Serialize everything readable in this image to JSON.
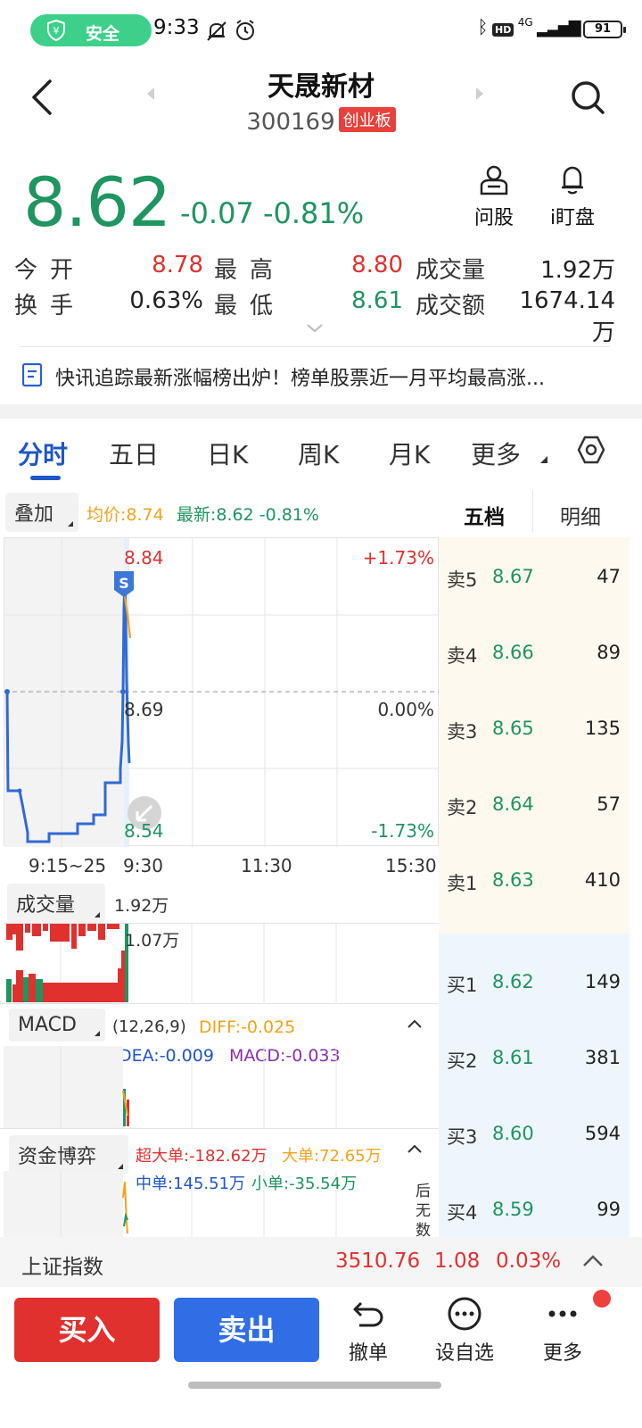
{
  "status_bar": {
    "safe_label": "安全",
    "time": "9:33",
    "battery": "91",
    "network": "4G"
  },
  "header": {
    "title": "天晟新材",
    "code": "300169",
    "board": "创业板"
  },
  "quote": {
    "price": "8.62",
    "change": "-0.07",
    "change_pct": "-0.81%",
    "ask_label": "问股",
    "watch_label": "i盯盘"
  },
  "stats": [
    {
      "label": "今开",
      "value": "8.78",
      "color": "red"
    },
    {
      "label": "最高",
      "value": "8.80",
      "color": "red"
    },
    {
      "label": "成交量",
      "value": "1.92万",
      "color": "dark"
    },
    {
      "label": "换手",
      "value": "0.63%",
      "color": "dark"
    },
    {
      "label": "最低",
      "value": "8.61",
      "color": "green"
    },
    {
      "label": "成交额",
      "value": "1674.14万",
      "color": "dark"
    }
  ],
  "news": {
    "text": "快讯追踪最新涨幅榜出炉！榜单股票近一月平均最高涨..."
  },
  "tabs": [
    "分时",
    "五日",
    "日K",
    "周K",
    "月K",
    "更多"
  ],
  "legend": {
    "overlay_label": "叠加",
    "avg_text": "均价:8.74",
    "latest_text": "最新:8.62 -0.81%",
    "five_levels": "五档",
    "detail": "明细"
  },
  "chart": {
    "price_high": "8.84",
    "price_mid": "8.69",
    "price_low": "8.54",
    "pct_high": "+1.73%",
    "pct_mid": "0.00%",
    "pct_low": "-1.73%",
    "badge": "S",
    "times": [
      "9:15~25",
      "9:30",
      "11:30",
      "15:30"
    ]
  },
  "volume": {
    "label": "成交量",
    "value": "1.92万",
    "scale": "1.07万"
  },
  "macd": {
    "label": "MACD",
    "params": "(12,26,9)",
    "diff": "DIFF:-0.025",
    "dea": "DEA:-0.009",
    "macd": "MACD:-0.033"
  },
  "funds": {
    "label": "资金博弈",
    "super": "超大单:-182.62万",
    "large": "大单:72.65万",
    "medium": "中单:145.51万",
    "small": "小单:-35.54万",
    "note_chars": [
      "后",
      "无",
      "数"
    ]
  },
  "order_book": {
    "sell": [
      {
        "label": "卖5",
        "price": "8.67",
        "vol": "47"
      },
      {
        "label": "卖4",
        "price": "8.66",
        "vol": "89"
      },
      {
        "label": "卖3",
        "price": "8.65",
        "vol": "135"
      },
      {
        "label": "卖2",
        "price": "8.64",
        "vol": "57"
      },
      {
        "label": "卖1",
        "price": "8.63",
        "vol": "410"
      }
    ],
    "buy": [
      {
        "label": "买1",
        "price": "8.62",
        "vol": "149"
      },
      {
        "label": "买2",
        "price": "8.61",
        "vol": "381"
      },
      {
        "label": "买3",
        "price": "8.60",
        "vol": "594"
      },
      {
        "label": "买4",
        "price": "8.59",
        "vol": "99"
      }
    ]
  },
  "index_bar": {
    "name": "上证指数",
    "value": "3510.76",
    "change": "1.08",
    "pct": "0.03%"
  },
  "toolbar": {
    "buy": "买入",
    "sell": "卖出",
    "cancel": "撤单",
    "watch": "设自选",
    "more": "更多"
  },
  "colors": {
    "up": "#e0312f",
    "down": "#1f9560",
    "accent": "#1e57c6",
    "buy_button": "#e0312f",
    "sell_button": "#2f6ee5"
  }
}
